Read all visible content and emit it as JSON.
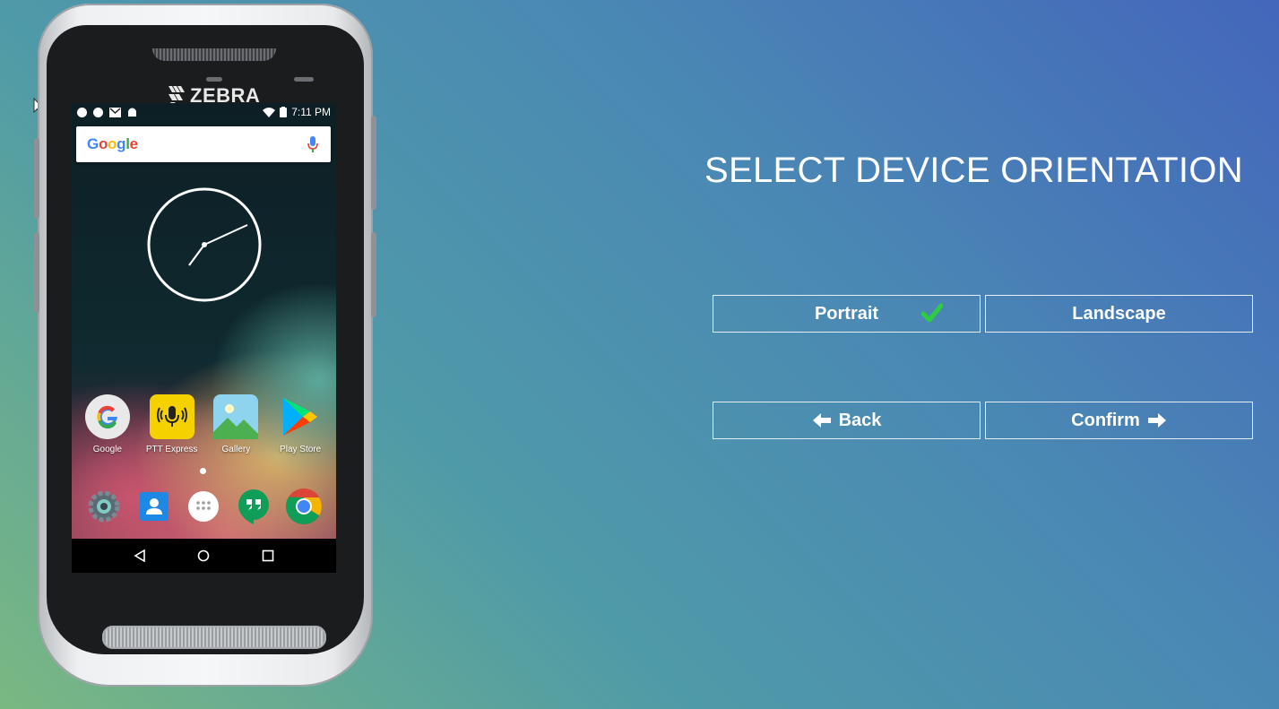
{
  "device": {
    "brand": "ZEBRA",
    "status_time": "7:11 PM",
    "search_brand": "Google",
    "home_apps": [
      {
        "label": "Google",
        "icon": "google-app-icon"
      },
      {
        "label": "PTT Express",
        "icon": "ptt-express-icon"
      },
      {
        "label": "Gallery",
        "icon": "gallery-icon"
      },
      {
        "label": "Play Store",
        "icon": "play-store-icon"
      }
    ],
    "dock_apps": [
      "settings-icon",
      "contacts-icon",
      "app-drawer-icon",
      "hangouts-icon",
      "chrome-icon"
    ]
  },
  "panel": {
    "title": "SELECT DEVICE ORIENTATION",
    "portrait_label": "Portrait",
    "landscape_label": "Landscape",
    "back_label": "Back",
    "confirm_label": "Confirm",
    "selected_orientation": "Portrait"
  },
  "colors": {
    "check": "#2ecc40",
    "button_border": "#e6eef3",
    "bg_top_right": "#4466bb",
    "bg_bottom_left": "#7ab882"
  }
}
